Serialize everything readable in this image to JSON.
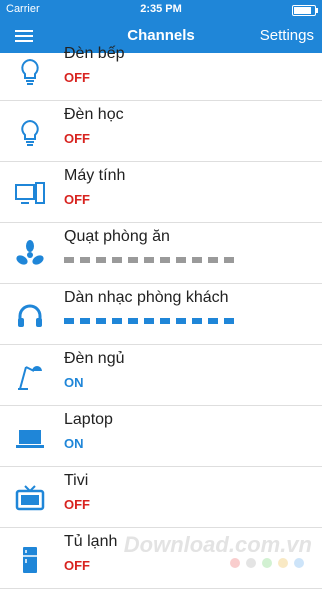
{
  "status_bar": {
    "carrier": "Carrier",
    "time": "2:35 PM"
  },
  "nav": {
    "title": "Channels",
    "settings_label": "Settings"
  },
  "channels": [
    {
      "name": "Đèn bếp",
      "status": "OFF",
      "icon": "bulb-icon"
    },
    {
      "name": "Đèn học",
      "status": "OFF",
      "icon": "bulb-icon"
    },
    {
      "name": "Máy tính",
      "status": "OFF",
      "icon": "computer-icon"
    },
    {
      "name": "Quạt phòng ăn",
      "status": "",
      "level": 0,
      "level_color": "#9a9a9a",
      "icon": "fan-icon"
    },
    {
      "name": "Dàn nhạc phòng khách",
      "status": "",
      "level": 1,
      "level_color": "#1f86d8",
      "icon": "headphones-icon"
    },
    {
      "name": "Đèn ngủ",
      "status": "ON",
      "icon": "desk-lamp-icon"
    },
    {
      "name": "Laptop",
      "status": "ON",
      "icon": "laptop-icon"
    },
    {
      "name": "Tivi",
      "status": "OFF",
      "icon": "tv-icon"
    },
    {
      "name": "Tủ lạnh",
      "status": "OFF",
      "icon": "fridge-icon"
    }
  ],
  "watermark": "Download.com.vn",
  "colors": {
    "accent": "#1f86d8",
    "off": "#d8231f",
    "divider": "#dedede"
  }
}
